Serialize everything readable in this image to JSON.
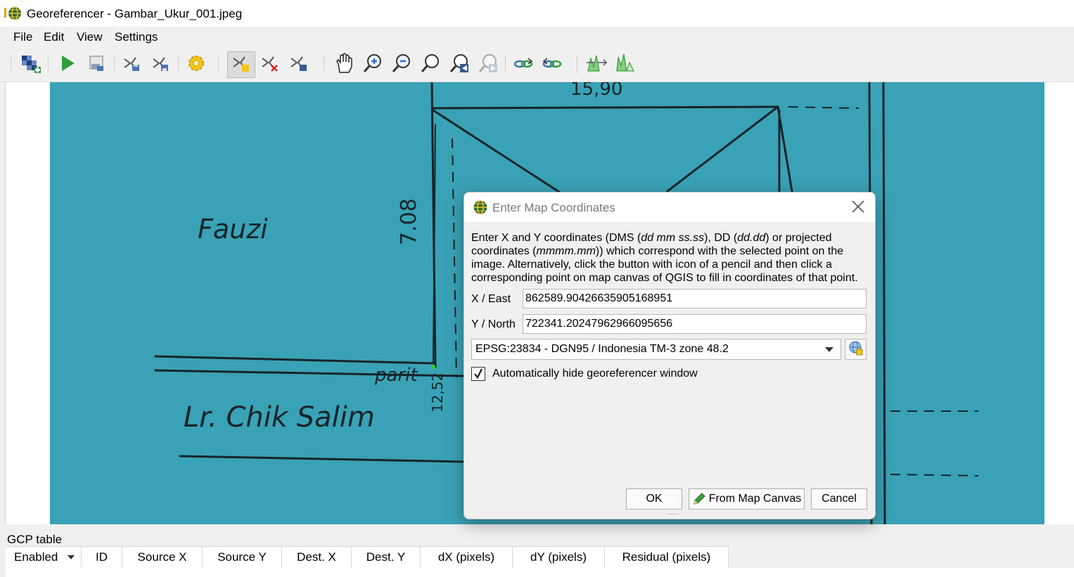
{
  "window": {
    "title": "Georeferencer - Gambar_Ukur_001.jpeg"
  },
  "menu": [
    "File",
    "Edit",
    "View",
    "Settings"
  ],
  "toolbar": {
    "icons": [
      "open-raster-icon",
      "start-georeferencing-icon",
      "generate-gdal-script-icon",
      "load-gcp-points-icon",
      "save-gcp-points-icon",
      "transformation-settings-icon",
      "add-point-icon",
      "delete-point-icon",
      "move-gcp-point-icon",
      "pan-icon",
      "zoom-in-icon",
      "zoom-out-icon",
      "zoom-to-layer-icon",
      "zoom-last-icon",
      "zoom-next-icon",
      "link-georeferencer-to-qgis-icon",
      "link-qgis-to-georeferencer-icon",
      "full-histogram-stretch-icon",
      "local-histogram-stretch-icon"
    ]
  },
  "canvas": {
    "image_color": "#3aa2b6",
    "handwriting": {
      "fauzi": "Fauzi",
      "measure_top": "15,90",
      "measure_side": "7.08",
      "parit": "parit",
      "measure_bottom": "12,52",
      "street": "Lr. Chik Salim"
    }
  },
  "dialog": {
    "title": "Enter Map Coordinates",
    "desc_parts": [
      "Enter X and Y coordinates (DMS (",
      "dd mm ss.ss",
      "), DD (",
      "dd.dd",
      ") or projected coordinates (",
      "mmmm.mm",
      ")) which correspond with the selected point on the image. Alternatively, click the button with icon of a pencil and then click a corresponding point on map canvas of QGIS to fill in coordinates of that point."
    ],
    "x_label": "X / East",
    "x_value": "862589.90426635905168951",
    "y_label": "Y / North",
    "y_value": "722341.20247962966095656",
    "crs": "EPSG:23834 - DGN95 / Indonesia TM-3 zone 48.2",
    "checkbox_label": "Automatically hide georeferencer window",
    "checkbox_checked": true,
    "buttons": {
      "ok": "OK",
      "from_map_canvas": "From Map Canvas",
      "cancel": "Cancel"
    }
  },
  "gcp": {
    "title": "GCP table",
    "columns": [
      "Enabled",
      "ID",
      "Source X",
      "Source Y",
      "Dest. X",
      "Dest. Y",
      "dX (pixels)",
      "dY (pixels)",
      "Residual (pixels)"
    ]
  }
}
